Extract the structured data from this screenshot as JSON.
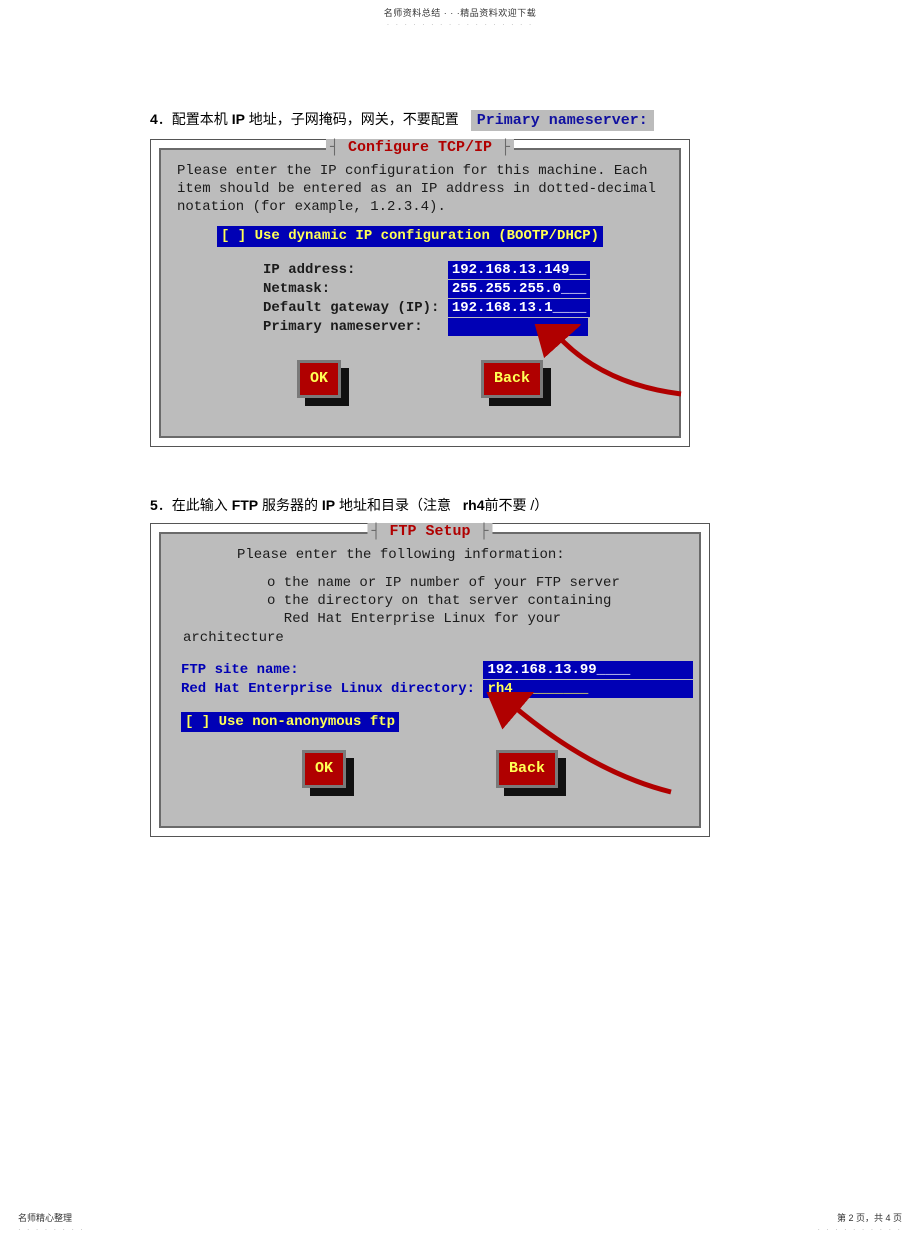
{
  "header": {
    "text": "名师资料总结 · · ·精品资料欢迎下载",
    "dots": "· · · · · · · · · · · · · · · · ·"
  },
  "step4": {
    "num": "4",
    "sep": "．",
    "text_pre": "配置本机 ",
    "ip_bold": "IP",
    "text_post": " 地址，子网掩码，网关，不要配置",
    "badge": "Primary nameserver:"
  },
  "dialog1": {
    "title": "Configure TCP/IP",
    "intro": "Please enter the IP configuration for this machine. Each item should be entered as an IP address in dotted-decimal notation (for example, 1.2.3.4).",
    "dhcp": "[ ] Use dynamic IP configuration (BOOTP/DHCP)",
    "rows": [
      {
        "label": "IP address:          ",
        "value": "192.168.13.149__"
      },
      {
        "label": "Netmask:             ",
        "value": "255.255.255.0___"
      },
      {
        "label": "Default gateway (IP):",
        "value": "192.168.13.1____"
      },
      {
        "label": "Primary nameserver:  ",
        "value": "              "
      }
    ],
    "ok": "OK",
    "back": "Back"
  },
  "step5": {
    "num": "5",
    "sep": "．",
    "text_pre": "在此输入 ",
    "ftp_bold": "FTP",
    "text_mid": " 服务器的 ",
    "ip_bold": "IP",
    "text_post1": " 地址和目录（注意",
    "rh4_bold": "rh4",
    "text_post2": "前不要 /）"
  },
  "dialog2": {
    "title": "FTP Setup",
    "intro1": "Please enter the following information:",
    "bullet1": "o the name or IP number of your FTP server",
    "bullet2": "o the directory on that server containing",
    "bullet3": "  Red Hat Enterprise Linux for your",
    "arch": "architecture",
    "rows": [
      {
        "label": "FTP site name:                      ",
        "value": "192.168.13.99____"
      },
      {
        "label": "Red Hat Enterprise Linux directory: ",
        "value": "rh4_________"
      }
    ],
    "anon": "[ ] Use non-anonymous ftp",
    "ok": "OK",
    "back": "Back"
  },
  "footer": {
    "left": "名师精心整理",
    "left_dots": "· · · · · · · ·",
    "right": "第 2 页，共 4 页",
    "right_dots": "· · · · · · · · · ·"
  }
}
